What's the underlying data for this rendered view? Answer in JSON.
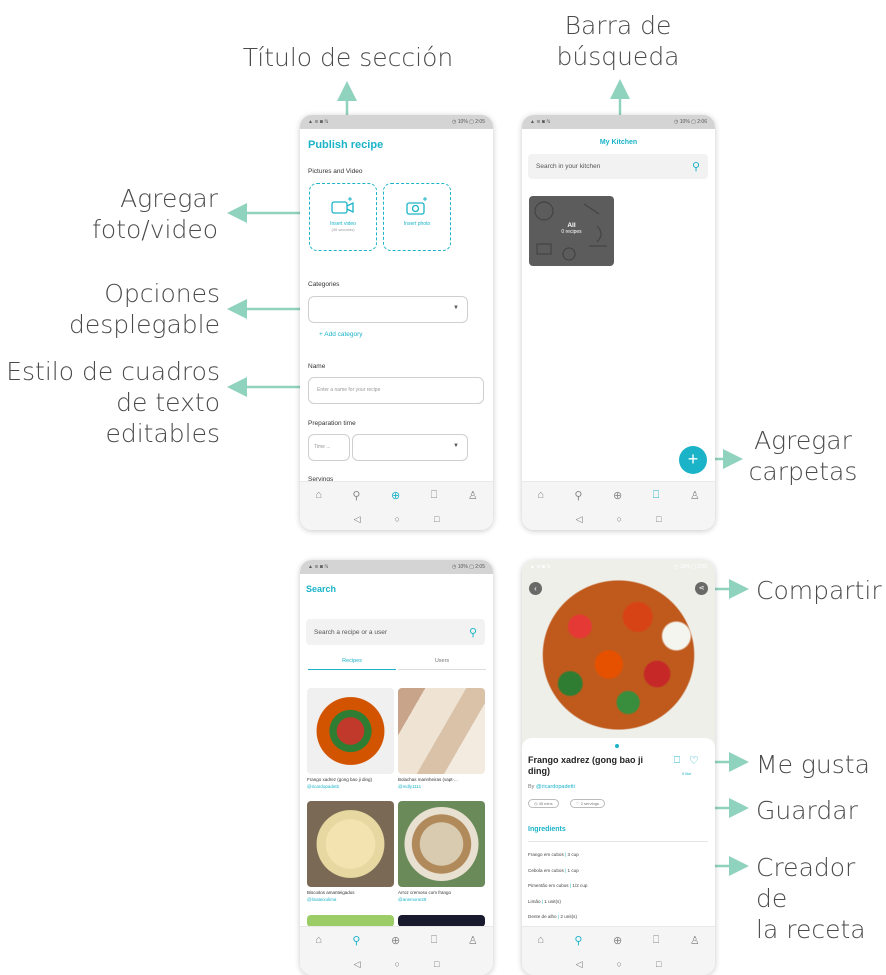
{
  "annotations": {
    "section_title": "Título de sección",
    "search_bar_1": "Barra de",
    "search_bar_2": "búsqueda",
    "add_media_1": "Agregar",
    "add_media_2": "foto/video",
    "dropdown_1": "Opciones",
    "dropdown_2": "desplegable",
    "textbox_1": "Estilo de cuadros",
    "textbox_2": "de texto editables",
    "add_folders_1": "Agregar",
    "add_folders_2": "carpetas",
    "share": "Compartir",
    "like": "Me gusta",
    "save": "Guardar",
    "creator_1": "Creador de",
    "creator_2": "la receta"
  },
  "status": {
    "left": "▲ ≋ ◙ ℕ",
    "right": "◷ 10% ▢ 2:05",
    "right2": "◷ 10% ▢ 2:06"
  },
  "publish": {
    "title": "Publish recipe",
    "pictures_label": "Pictures and Video",
    "insert_video": "Insert video",
    "video_limit": "(45 seconds)",
    "insert_photo": "Insert photo",
    "categories_label": "Categories",
    "add_category": "+ Add category",
    "name_label": "Name",
    "name_placeholder": "Enter a name for your recipe",
    "prep_label": "Preparation time",
    "time_placeholder": "Time ...",
    "servings_label": "Servings"
  },
  "kitchen": {
    "title": "My Kitchen",
    "search_placeholder": "Search in your kitchen",
    "folder_name": "All",
    "folder_count": "0 recipes",
    "fab": "+"
  },
  "search": {
    "title": "Search",
    "placeholder": "Search a recipe or a user",
    "tab_recipes": "Recipes",
    "tab_users": "Users",
    "results": [
      {
        "title": "Frango xadrez (gong bao ji ding)",
        "author": "@ricardopadetti"
      },
      {
        "title": "Bolachas marinheiras (vapt-...",
        "author": "@mdly1111"
      },
      {
        "title": "Biscoitos amanteigados",
        "author": "@linateixolima"
      },
      {
        "title": "Arroz cremoso com frango",
        "author": "@anemone29"
      }
    ]
  },
  "recipe": {
    "title": "Frango xadrez (gong bao ji ding)",
    "by": "By",
    "author": "@ricardopadetti",
    "likes": "0 like",
    "time_chip": "45 mins",
    "servings_chip": "2 servings",
    "ingredients_label": "Ingredients",
    "ingredients": [
      {
        "name": "Frango em cubos",
        "qty": "3 cup"
      },
      {
        "name": "Cebola em cubos",
        "qty": "1 cup"
      },
      {
        "name": "Pimentão em cubos",
        "qty": "1/2 cup"
      },
      {
        "name": "Limão",
        "qty": "1 unit(s)"
      },
      {
        "name": "Dente de alho",
        "qty": "2 unit(s)"
      }
    ]
  },
  "nav_icons": [
    "home-icon",
    "search-icon",
    "add-icon",
    "bookmark-icon",
    "profile-icon"
  ],
  "colors": {
    "accent": "#1ab3c8",
    "arrow": "#8fd3bf"
  }
}
